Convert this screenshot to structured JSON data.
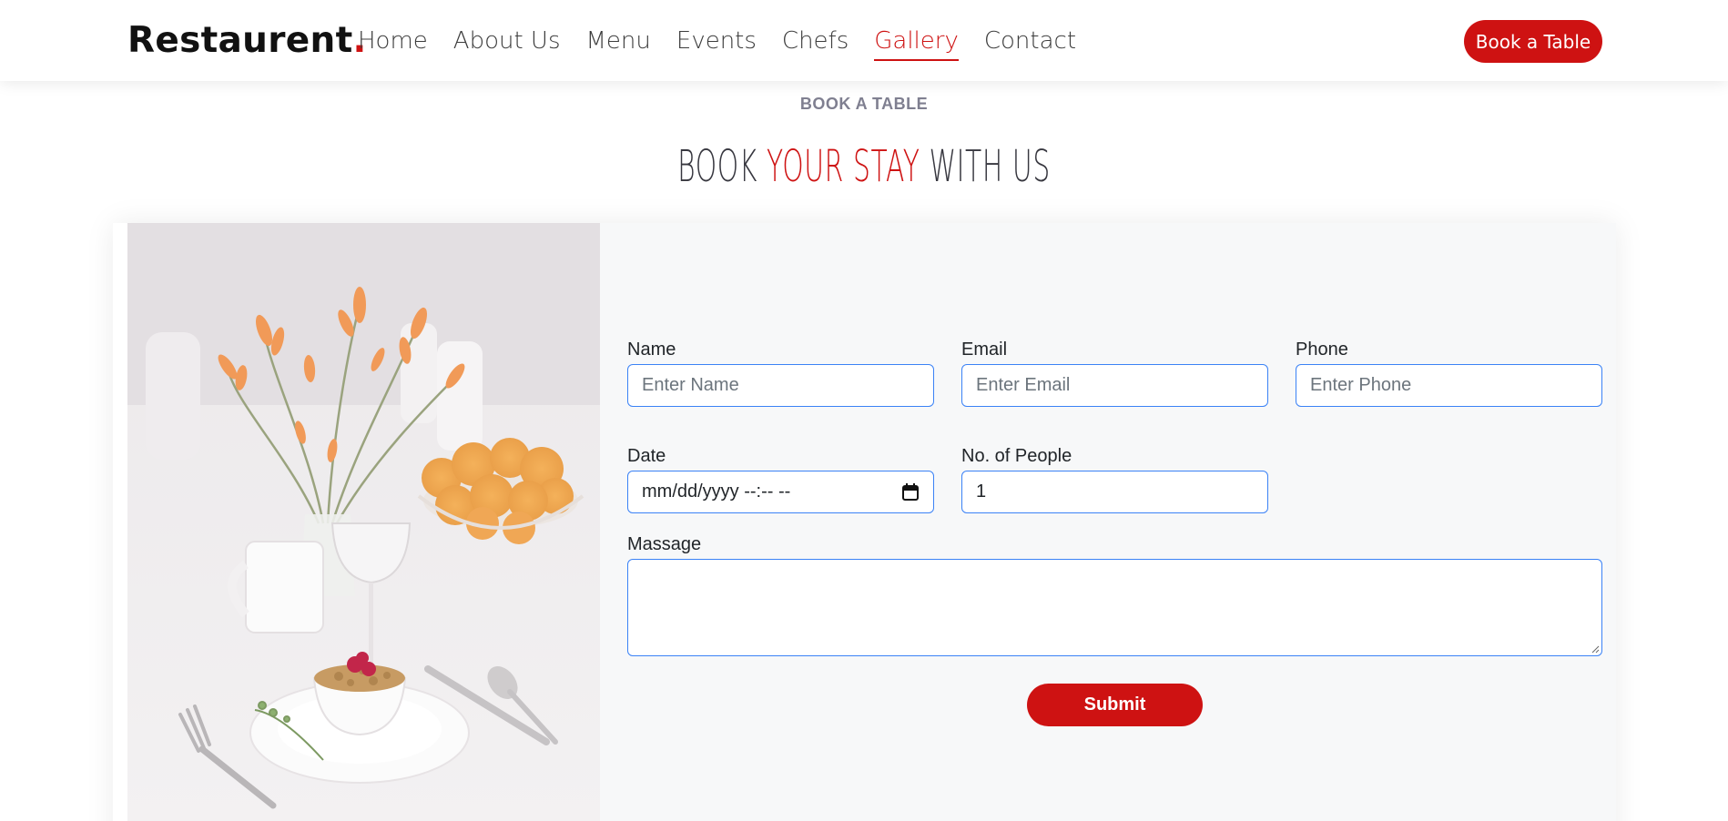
{
  "header": {
    "logo_text": "Restaurent",
    "logo_dot": ".",
    "nav": [
      {
        "label": "Home"
      },
      {
        "label": "About Us"
      },
      {
        "label": "Menu"
      },
      {
        "label": "Events"
      },
      {
        "label": "Chefs"
      },
      {
        "label": "Gallery",
        "active": true
      },
      {
        "label": "Contact"
      }
    ],
    "cta_label": "Book a Table"
  },
  "section": {
    "eyebrow": "BOOK A TABLE",
    "title_part1": "BOOK",
    "title_accent": "YOUR STAY",
    "title_part2": "WITH US"
  },
  "form": {
    "name_label": "Name",
    "name_placeholder": "Enter Name",
    "email_label": "Email",
    "email_placeholder": "Enter Email",
    "phone_label": "Phone",
    "phone_placeholder": "Enter Phone",
    "date_label": "Date",
    "date_value": "mm/dd/yyyy --:-- --",
    "people_label": "No. of People",
    "people_value": "1",
    "message_label": "Massage",
    "message_value": "",
    "submit_label": "Submit"
  },
  "colors": {
    "accent": "#ce1212",
    "input_border": "#3b82f6",
    "form_bg": "#f7f8f9"
  }
}
